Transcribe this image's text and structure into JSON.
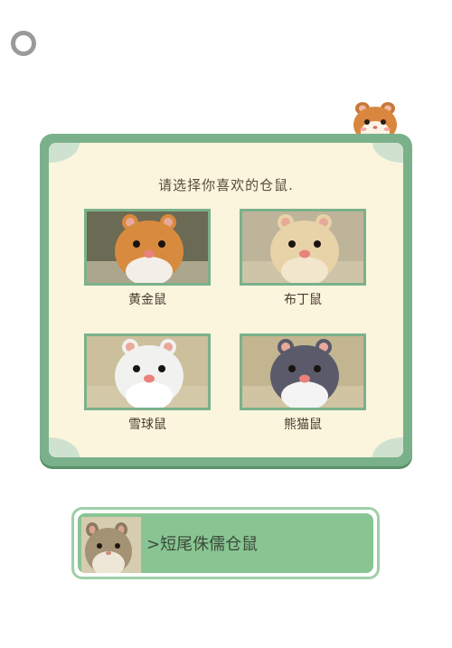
{
  "icons": {
    "settings": "ring-icon",
    "mascot": "hamster-face-icon"
  },
  "panel": {
    "prompt": "请选择你喜欢的仓鼠.",
    "options": [
      {
        "name": "黄金鼠",
        "fur": "#d88a3e",
        "belly": "#f3efe8",
        "bg": "#6a6a55"
      },
      {
        "name": "布丁鼠",
        "fur": "#e8d2a8",
        "belly": "#f2e6cc",
        "bg": "#bdb49a"
      },
      {
        "name": "雪球鼠",
        "fur": "#f1f1ef",
        "belly": "#ffffff",
        "bg": "#cbbf9c"
      },
      {
        "name": "熊猫鼠",
        "fur": "#5a5a6a",
        "belly": "#f4f4f4",
        "bg": "#c2b590"
      }
    ]
  },
  "variant_button": {
    "label": ">短尾侏儒仓鼠"
  },
  "colors": {
    "panel_border": "#7bb18a",
    "panel_fill": "#fbf5dd",
    "button_fill": "#88c592"
  }
}
